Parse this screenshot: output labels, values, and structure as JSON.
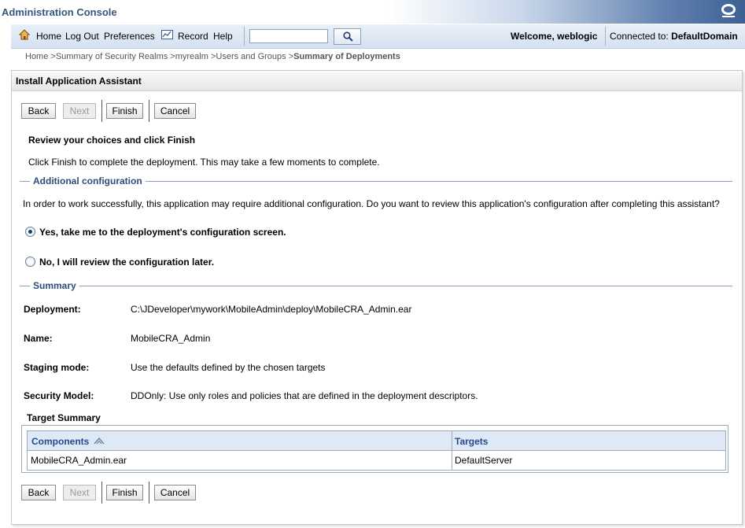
{
  "app": {
    "title": "Administration Console"
  },
  "nav": {
    "home": "Home",
    "logout": "Log Out",
    "preferences": "Preferences",
    "record": "Record",
    "help": "Help",
    "search_value": "",
    "welcome": "Welcome, weblogic",
    "connected_label": "Connected to:",
    "connected_domain": "DefaultDomain"
  },
  "breadcrumb": {
    "items": [
      "Home >",
      "Summary of Security Realms >",
      "myrealm >",
      "Users and Groups >"
    ],
    "current": "Summary of Deployments"
  },
  "assistant": {
    "title": "Install Application Assistant",
    "buttons": {
      "back": "Back",
      "next": "Next",
      "finish": "Finish",
      "cancel": "Cancel"
    },
    "heading": "Review your choices and click Finish",
    "intro": "Click Finish to complete the deployment. This may take a few moments to complete.",
    "additional_config": {
      "title": "Additional configuration",
      "description": "In order to work successfully, this application may require additional configuration. Do you want to review this application's configuration after completing this assistant?",
      "option_yes": "Yes, take me to the deployment's configuration screen.",
      "option_no": "No, I will review the configuration later.",
      "selected": "yes"
    },
    "summary": {
      "title": "Summary",
      "rows": [
        {
          "label": "Deployment:",
          "value": "C:\\JDeveloper\\mywork\\MobileAdmin\\deploy\\MobileCRA_Admin.ear"
        },
        {
          "label": "Name:",
          "value": "MobileCRA_Admin"
        },
        {
          "label": "Staging mode:",
          "value": "Use the defaults defined by the chosen targets"
        },
        {
          "label": "Security Model:",
          "value": "DDOnly: Use only roles and policies that are defined in the deployment descriptors."
        }
      ]
    },
    "target_summary": {
      "title": "Target Summary",
      "columns": [
        "Components",
        "Targets"
      ],
      "rows": [
        {
          "component": "MobileCRA_Admin.ear",
          "target": "DefaultServer"
        }
      ]
    }
  }
}
